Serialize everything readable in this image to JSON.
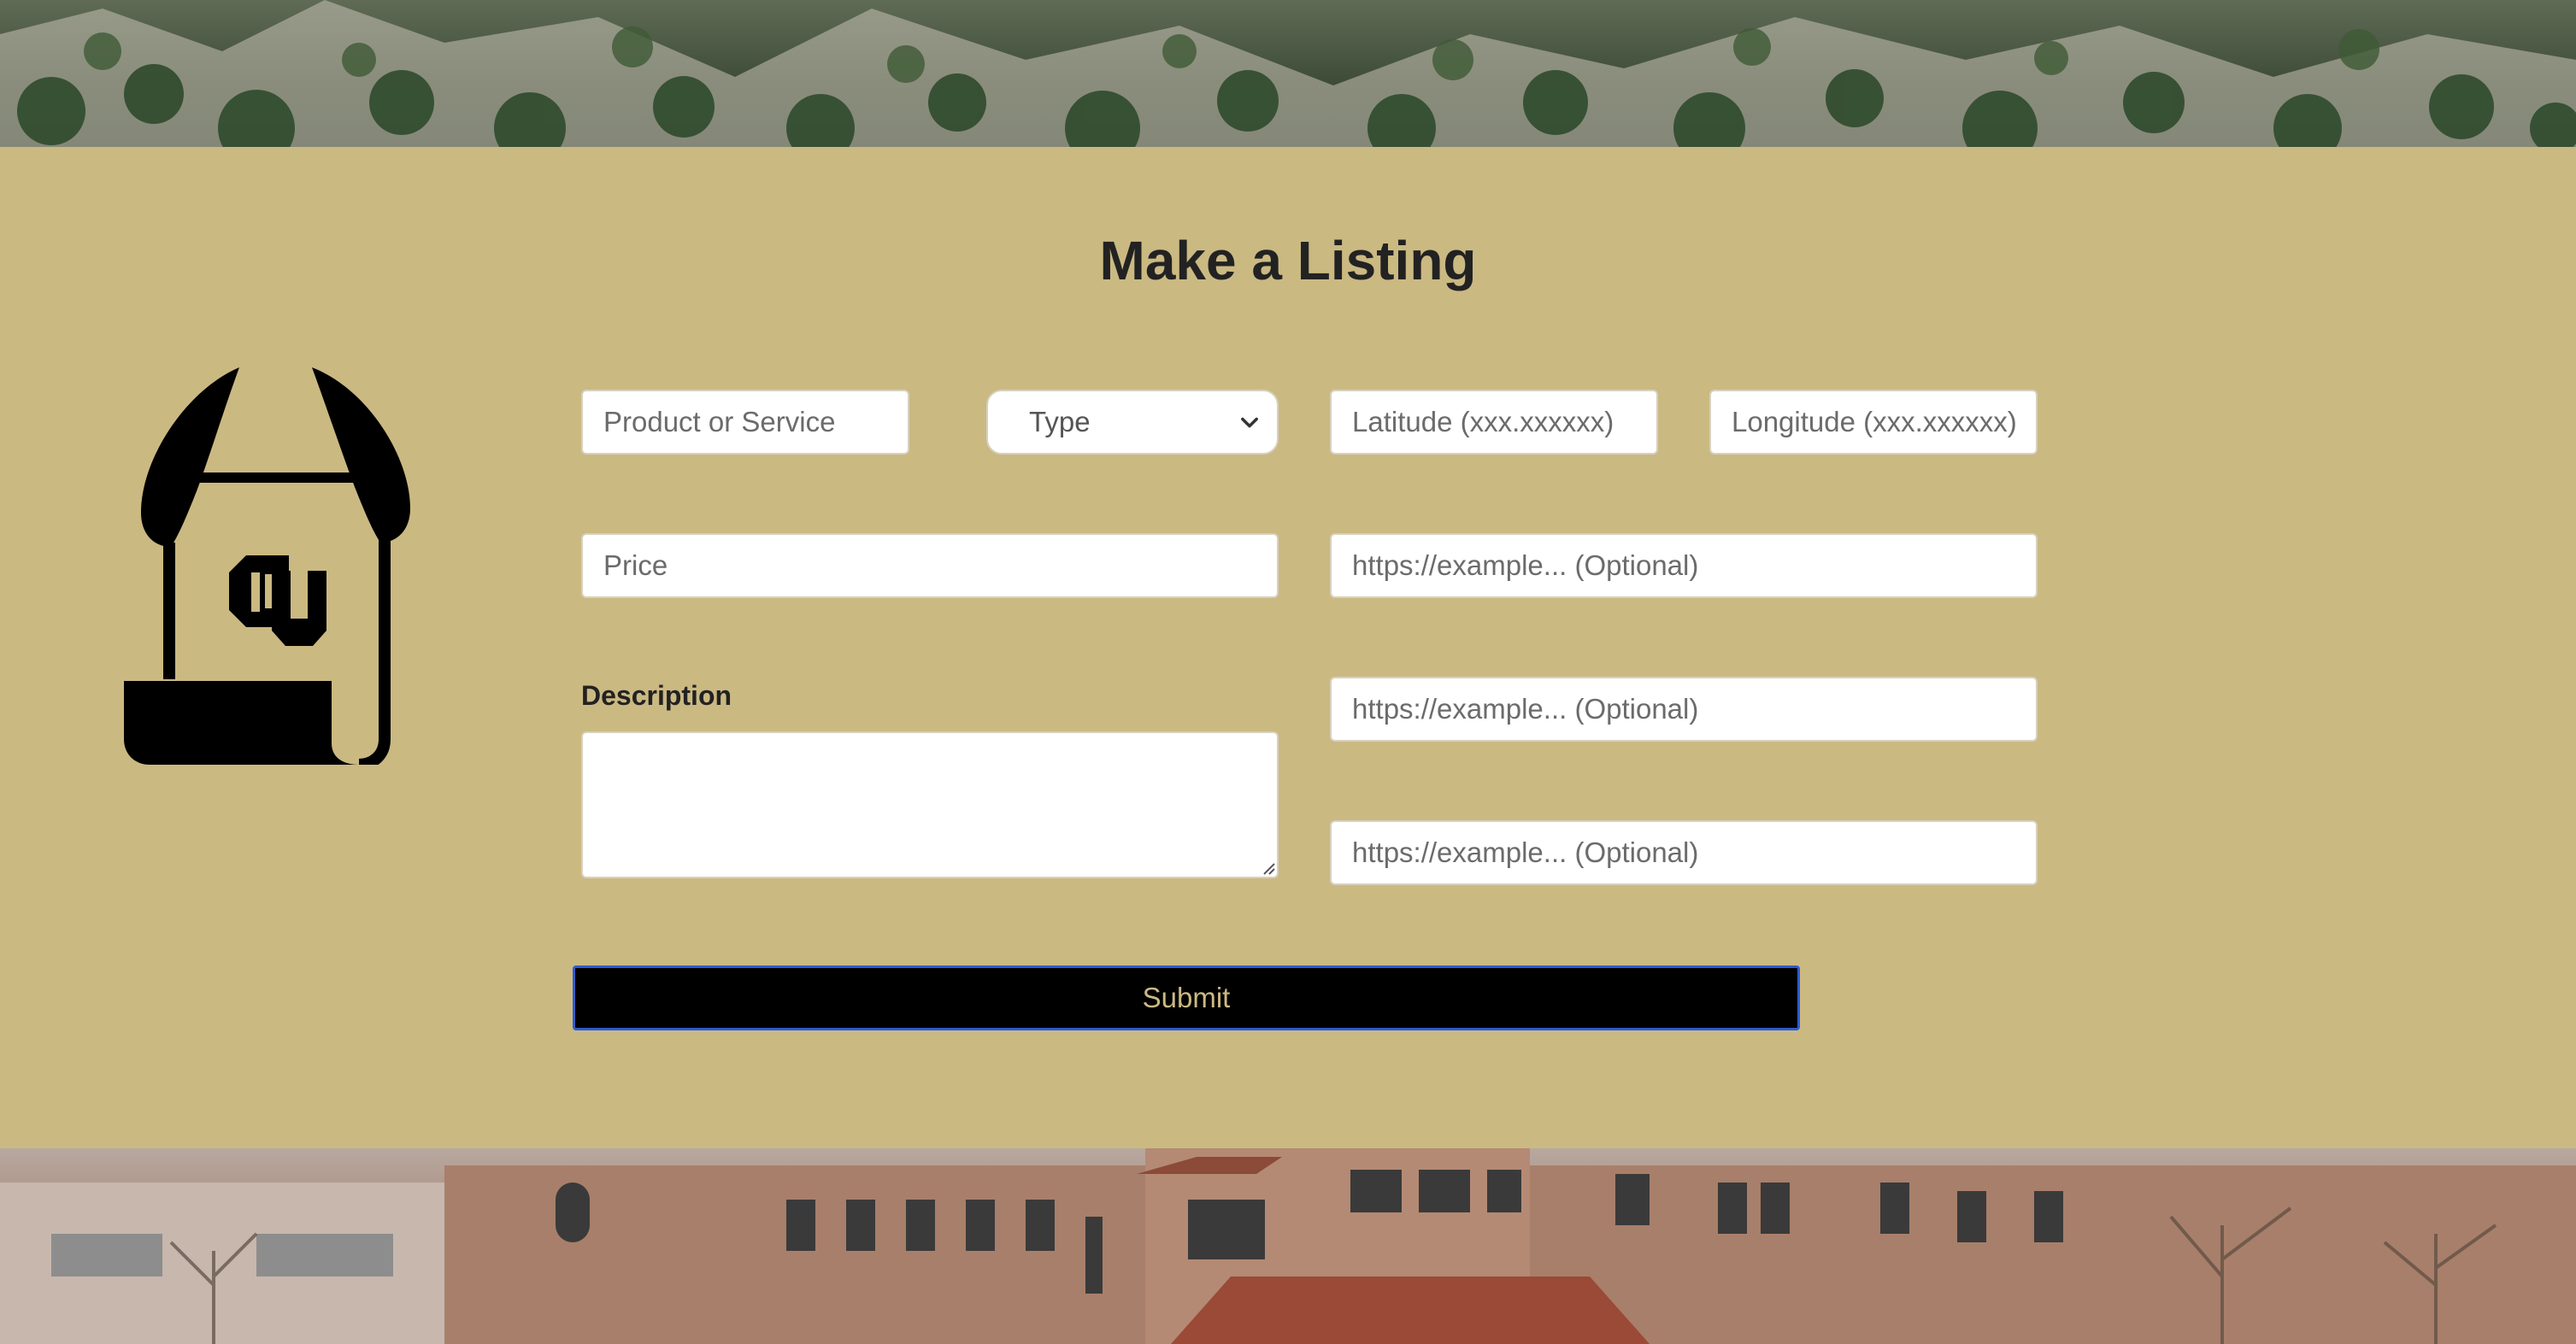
{
  "form": {
    "title": "Make a Listing",
    "product_placeholder": "Product or Service",
    "type_label": "Type",
    "latitude_placeholder": "Latitude (xxx.xxxxxx)",
    "longitude_placeholder": "Longitude (xxx.xxxxxx)",
    "price_placeholder": "Price",
    "link_placeholder_1": "https://example... (Optional)",
    "link_placeholder_2": "https://example... (Optional)",
    "link_placeholder_3": "https://example... (Optional)",
    "description_label": "Description",
    "submit_label": "Submit"
  },
  "colors": {
    "background": "#cbb982",
    "submit_bg": "#000000",
    "submit_text": "#cbb982",
    "submit_border": "#2d5bd0"
  },
  "icons": {
    "logo": "buffalo-scroll-cu-logo-icon",
    "select_chevron": "chevron-down-icon"
  }
}
